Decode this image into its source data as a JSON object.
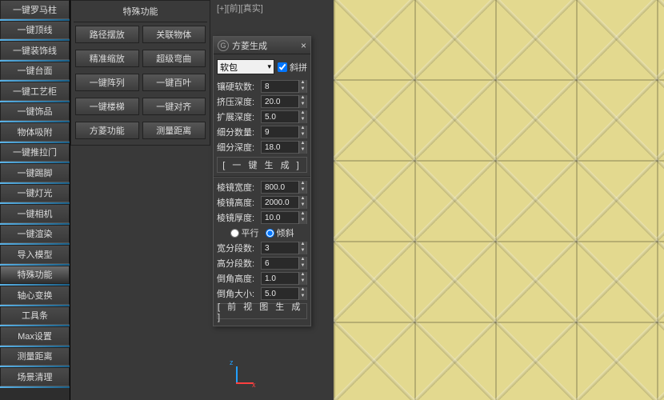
{
  "sidebar": [
    {
      "label": "一键罗马柱"
    },
    {
      "label": "一键顶线"
    },
    {
      "label": "一键装饰线"
    },
    {
      "label": "一键台面"
    },
    {
      "label": "一键工艺柜"
    },
    {
      "label": "一键饰品"
    },
    {
      "label": "物体吸附"
    },
    {
      "label": "一键推拉门"
    },
    {
      "label": "一键踢脚"
    },
    {
      "label": "一键灯光"
    },
    {
      "label": "一键相机"
    },
    {
      "label": "一键渲染"
    },
    {
      "label": "导入模型"
    },
    {
      "label": "特殊功能",
      "active": true
    },
    {
      "label": "轴心变换"
    },
    {
      "label": "工具条"
    },
    {
      "label": "Max设置"
    },
    {
      "label": "测量距离"
    },
    {
      "label": "场景清理"
    }
  ],
  "panel1": {
    "title": "特殊功能",
    "rows": [
      [
        "路径摆放",
        "关联物体"
      ],
      [
        "精准缩放",
        "超级弯曲"
      ],
      [
        "一键阵列",
        "一键百叶"
      ],
      [
        "一键楼梯",
        "一键对齐"
      ],
      [
        "方菱功能",
        "测量距离"
      ]
    ]
  },
  "viewlabel": "[+][前][真实]",
  "floatwin": {
    "title": "方菱生成",
    "sel": "软包",
    "chk": "斜拼",
    "params1": [
      {
        "l": "镶硬软数:",
        "v": "8"
      },
      {
        "l": "挤压深度:",
        "v": "20.0"
      },
      {
        "l": "扩展深度:",
        "v": "5.0"
      },
      {
        "l": "细分数量:",
        "v": "9"
      },
      {
        "l": "细分深度:",
        "v": "18.0"
      }
    ],
    "gen1": "[ 一 键 生 成 ]",
    "params2": [
      {
        "l": "棱镜宽度:",
        "v": "800.0"
      },
      {
        "l": "棱镜高度:",
        "v": "2000.0"
      },
      {
        "l": "棱镜厚度:",
        "v": "10.0"
      }
    ],
    "rad": {
      "a": "平行",
      "b": "倾斜"
    },
    "params3": [
      {
        "l": "宽分段数:",
        "v": "3"
      },
      {
        "l": "高分段数:",
        "v": "6"
      },
      {
        "l": "倒角高度:",
        "v": "1.0"
      },
      {
        "l": "倒角大小:",
        "v": "5.0"
      }
    ],
    "gen2": "[ 前 视 图 生 成 ]"
  }
}
